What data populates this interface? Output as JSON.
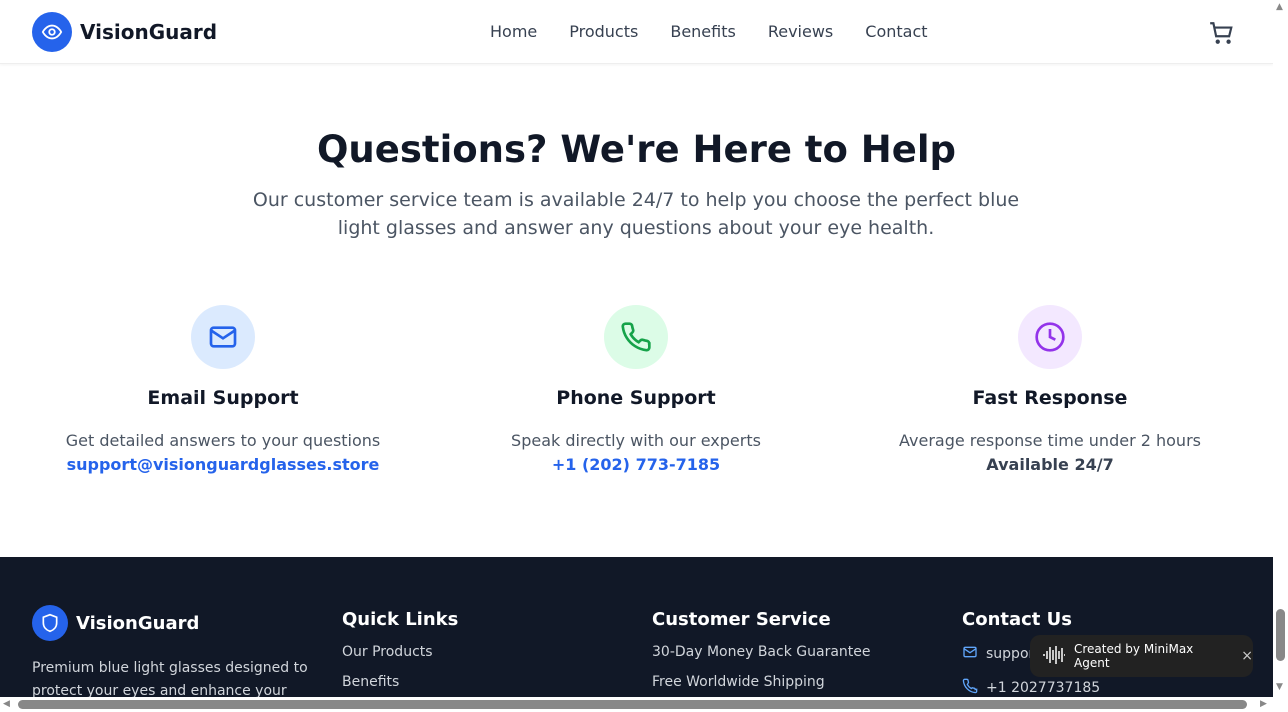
{
  "header": {
    "brand": "VisionGuard",
    "nav": [
      "Home",
      "Products",
      "Benefits",
      "Reviews",
      "Contact"
    ]
  },
  "hero": {
    "title": "Questions? We're Here to Help",
    "subtitle": "Our customer service team is available 24/7 to help you choose the perfect blue light glasses and answer any questions about your eye health."
  },
  "cards": [
    {
      "title": "Email Support",
      "text": "Get detailed answers to your questions",
      "value": "support@visionguardglasses.store",
      "icon": "mail-icon",
      "color": "#2563eb",
      "bg": "#dbeafe"
    },
    {
      "title": "Phone Support",
      "text": "Speak directly with our experts",
      "value": "+1 (202) 773-7185",
      "icon": "phone-icon",
      "color": "#16a34a",
      "bg": "#dcfce7"
    },
    {
      "title": "Fast Response",
      "text": "Average response time under 2 hours",
      "value": "Available 24/7",
      "icon": "clock-icon",
      "color": "#9333ea",
      "bg": "#f3e8ff"
    }
  ],
  "footer": {
    "brand": "VisionGuard",
    "description": "Premium blue light glasses designed to protect your eyes and enhance your",
    "quick_links": {
      "title": "Quick Links",
      "items": [
        "Our Products",
        "Benefits"
      ]
    },
    "customer_service": {
      "title": "Customer Service",
      "items": [
        "30-Day Money Back Guarantee",
        "Free Worldwide Shipping"
      ]
    },
    "contact": {
      "title": "Contact Us",
      "email": "support@visionguardglasses.store",
      "phone": "+1 2027737185"
    }
  },
  "toast": {
    "label": "Created by MiniMax Agent",
    "close": "×"
  }
}
